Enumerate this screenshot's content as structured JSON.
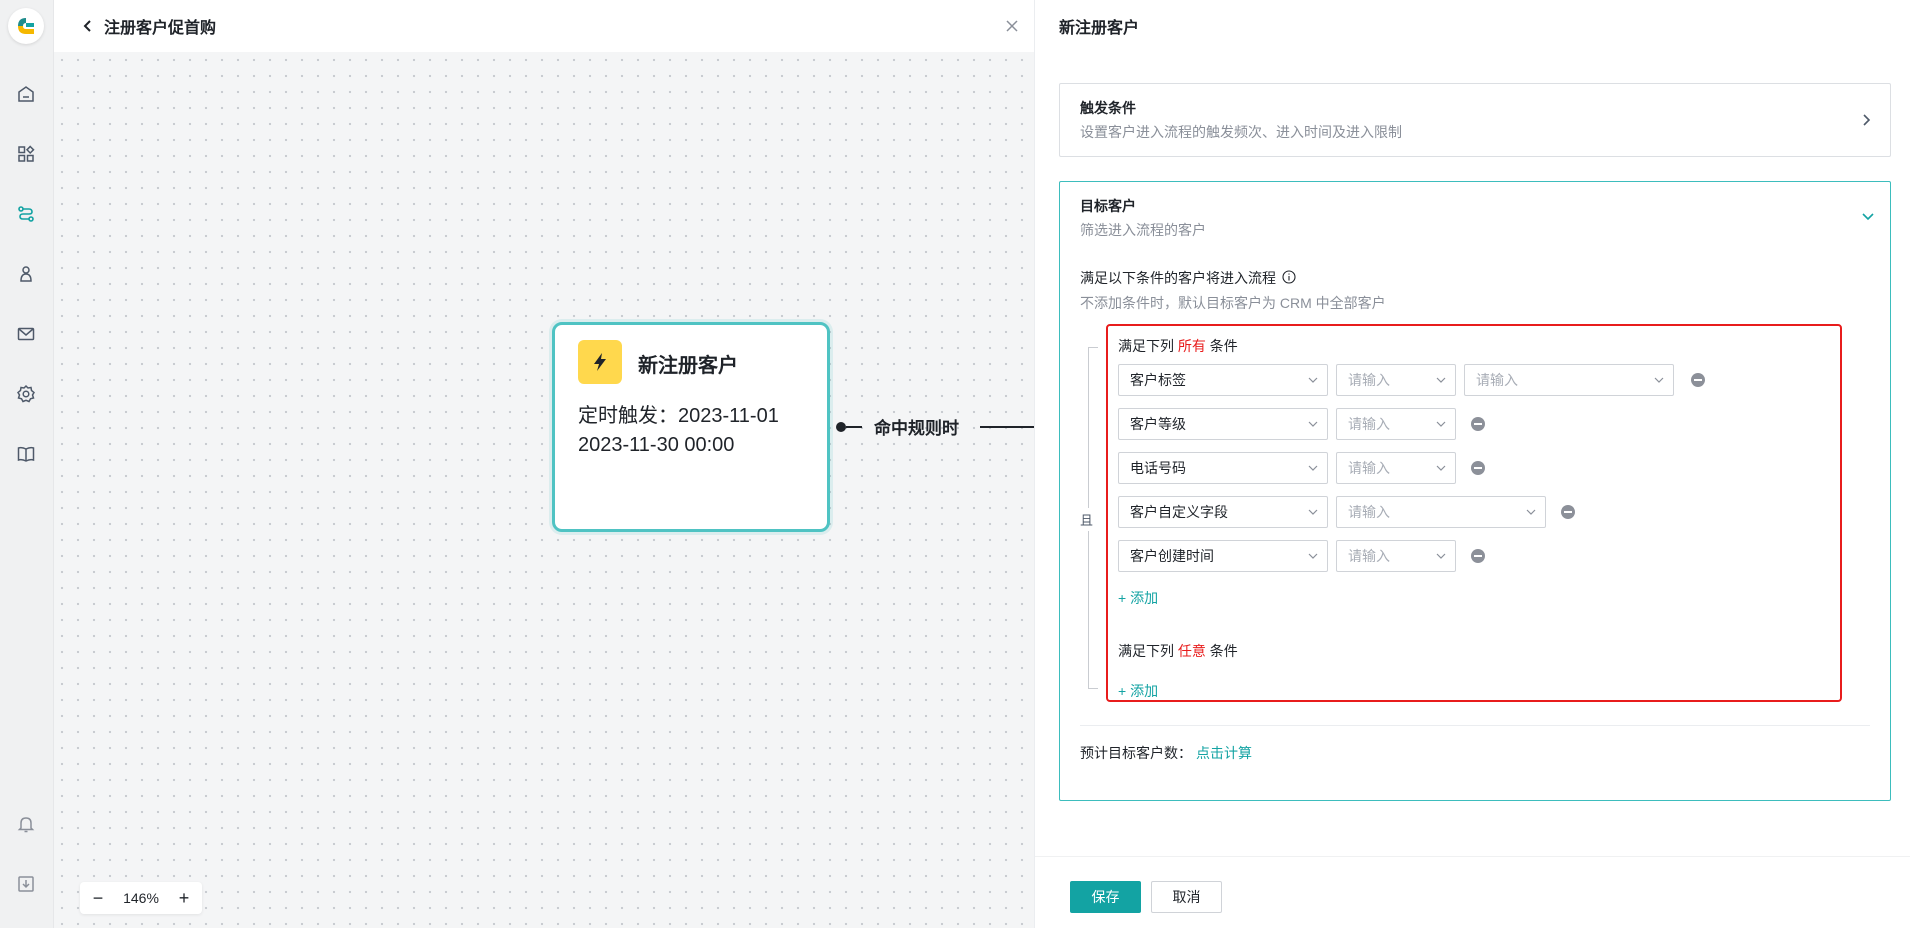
{
  "flow": {
    "title": "注册客户促首购",
    "zoom_level": "146%",
    "zoom_out": "−",
    "zoom_in": "+"
  },
  "node": {
    "title": "新注册客户",
    "body": "定时触发：2023-11-01 2023-11-30 00:00"
  },
  "connector": {
    "label": "命中规则时"
  },
  "panel": {
    "title": "新注册客户",
    "trigger_card": {
      "title": "触发条件",
      "desc": "设置客户进入流程的触发频次、进入时间及进入限制"
    },
    "target_card": {
      "title": "目标客户",
      "desc": "筛选进入流程的客户",
      "cond_title": "满足以下条件的客户将进入流程",
      "cond_hint": "不添加条件时，默认目标客户为 CRM 中全部客户",
      "and_label": "且",
      "group_all": {
        "prefix": "满足下列",
        "em": "所有",
        "suffix": "条件",
        "rows": [
          {
            "field": "客户标签",
            "op": "请输入",
            "value": "请输入"
          },
          {
            "field": "客户等级",
            "op": "请输入"
          },
          {
            "field": "电话号码",
            "op": "请输入"
          },
          {
            "field": "客户自定义字段",
            "op": "请输入"
          },
          {
            "field": "客户创建时间",
            "op": "请输入"
          }
        ],
        "add": "+ 添加"
      },
      "group_any": {
        "prefix": "满足下列",
        "em": "任意",
        "suffix": "条件",
        "add": "+ 添加"
      },
      "estimate_label": "预计目标客户数：",
      "estimate_link": "点击计算"
    },
    "save": "保存",
    "cancel": "取消"
  },
  "colors": {
    "accent": "#13a3a3",
    "highlight_border": "#e81c1c",
    "node_border": "#4fc3c3",
    "node_icon_bg": "#ffd84d"
  }
}
